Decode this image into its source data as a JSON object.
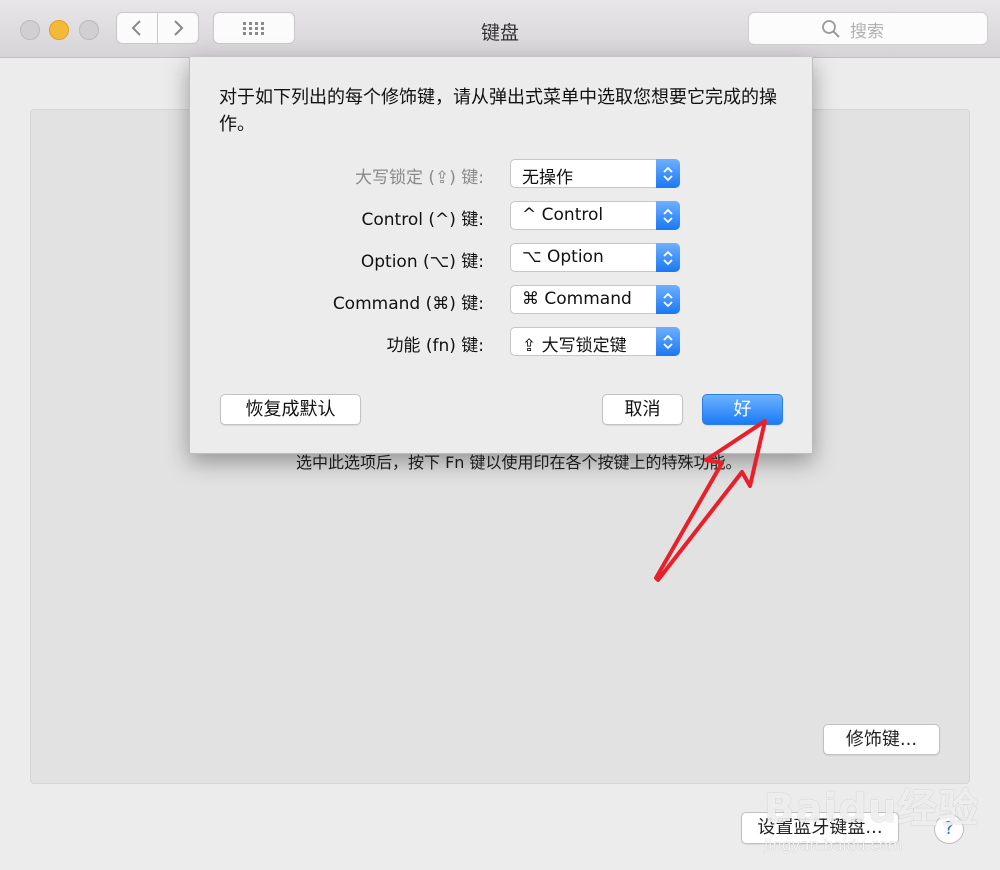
{
  "window": {
    "title": "键盘",
    "search_placeholder": "搜索",
    "nav_back_icon": "chevron-left-icon",
    "nav_forward_icon": "chevron-right-icon",
    "grid_icon": "grid-icon"
  },
  "background": {
    "fn_description": "选中此选项后，按下 Fn 键以使用印在各个按键上的特殊功能。",
    "modifier_keys_button": "修饰键...",
    "bluetooth_button": "设置蓝牙键盘...",
    "help_button": "?"
  },
  "sheet": {
    "instruction": "对于如下列出的每个修饰键，请从弹出式菜单中选取您想要它完成的操作。",
    "rows": [
      {
        "label": "大写锁定 (⇪) 键:",
        "value": "无操作",
        "disabled": true
      },
      {
        "label": "Control (^) 键:",
        "value": "^ Control",
        "disabled": false
      },
      {
        "label": "Option (⌥) 键:",
        "value": "⌥ Option",
        "disabled": false
      },
      {
        "label": "Command (⌘) 键:",
        "value": "⌘ Command",
        "disabled": false
      },
      {
        "label": "功能 (fn) 键:",
        "value": "⇪ 大写锁定键",
        "disabled": false
      }
    ],
    "restore_defaults_button": "恢复成默认",
    "cancel_button": "取消",
    "ok_button": "好"
  },
  "watermark": {
    "text": "Baidu经验",
    "sub": "jingyan.baidu.com"
  },
  "colors": {
    "accent_blue": "#1b7af5",
    "annotation_red": "#e8202a",
    "minimize_yellow": "#f5b93a"
  }
}
